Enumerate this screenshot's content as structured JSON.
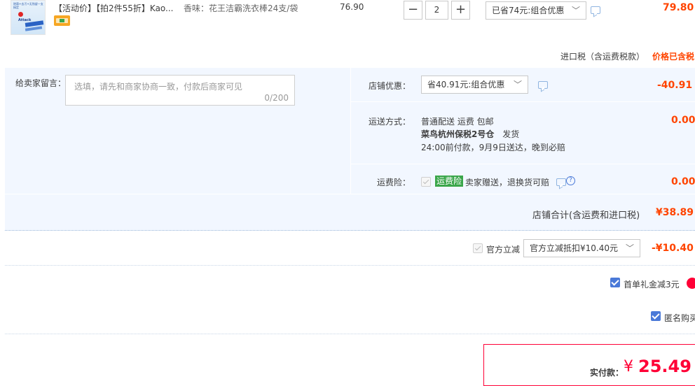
{
  "item": {
    "title": "【活动价】【拍2件55折】Kao...",
    "attr": "香味：花王洁霸洗衣棒24支/袋",
    "unit_price": "76.90",
    "quantity": "2",
    "promo_select": "已省74元:组合优惠",
    "subtotal": "79.80",
    "thumb_texts": [
      "除菌+去污+无残留一支搞定",
      "Attack"
    ]
  },
  "tax": {
    "label": "进口税（含运费税款）",
    "value": "价格已含税"
  },
  "message": {
    "label": "给卖家留言：",
    "placeholder": "选填，请先和商家协商一致，付款后商家可见",
    "counter": "0/200"
  },
  "shop_discount": {
    "label": "店铺优惠：",
    "select": "省40.91元:组合优惠",
    "value": "-40.91"
  },
  "shipping": {
    "label": "运送方式：",
    "line1": "普通配送 运费 包邮",
    "warehouse": "菜鸟杭州保税2号仓",
    "ship_word": "发货",
    "line3": "24:00前付款，9月9日送达，晚到必赔",
    "value": "0.00"
  },
  "insurance": {
    "label": "运费险：",
    "tag": "运费险",
    "text": "卖家赠送，退换货可赔",
    "value": "0.00"
  },
  "shop_total": {
    "label": "店铺合计(含运费和进口税)",
    "value": "¥38.89"
  },
  "official": {
    "check_label": "官方立减",
    "select": "官方立减抵扣¥10.40元",
    "value": "-¥10.40"
  },
  "first_order": {
    "label": "首单礼金减3元"
  },
  "anonymous": {
    "label": "匿名购买"
  },
  "pay": {
    "label": "实付款：",
    "currency": "¥",
    "amount": "25.49"
  },
  "colors": {
    "accent": "#ff0036",
    "price_red": "#f40",
    "blue_bg": "#f2f7ff",
    "checkbox": "#4a79d8",
    "insurance_tag": "#3aa64a"
  }
}
